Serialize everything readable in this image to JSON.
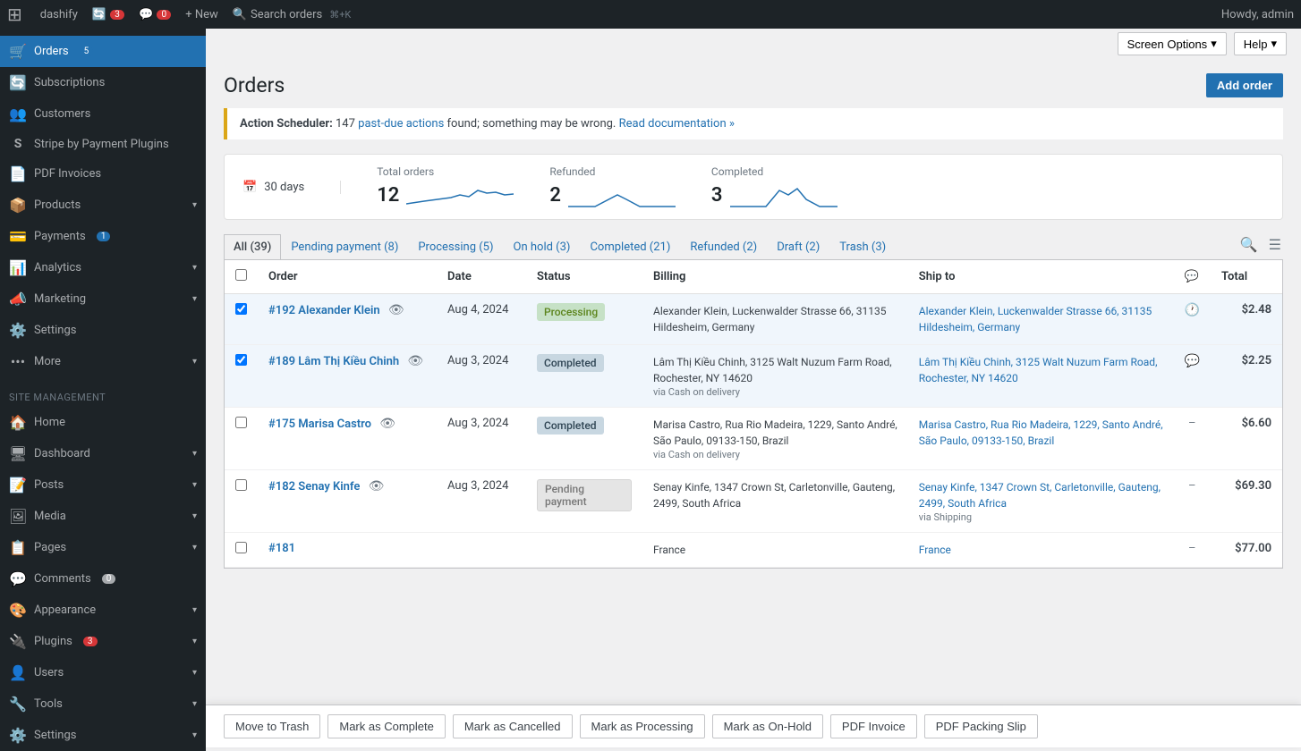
{
  "adminbar": {
    "logo": "W",
    "site_name": "dashify",
    "updates_count": "3",
    "comments_count": "0",
    "new_label": "+ New",
    "search_label": "Search orders",
    "search_shortcut": "⌘+K",
    "howdy": "Howdy, admin"
  },
  "top_bar": {
    "screen_options": "Screen Options",
    "help": "Help"
  },
  "page": {
    "title": "Orders",
    "add_order_label": "Add order"
  },
  "notice": {
    "prefix": "Action Scheduler:",
    "count": "147",
    "link1_text": "past-due actions",
    "middle": "found; something may be wrong.",
    "link2_text": "Read documentation »"
  },
  "stats": {
    "period_icon": "📅",
    "period_label": "30 days",
    "total_orders_label": "Total orders",
    "total_orders_value": "12",
    "refunded_label": "Refunded",
    "refunded_value": "2",
    "completed_label": "Completed",
    "completed_value": "3"
  },
  "tabs": [
    {
      "label": "All (39)",
      "key": "all",
      "active": true
    },
    {
      "label": "Pending payment (8)",
      "key": "pending",
      "active": false
    },
    {
      "label": "Processing (5)",
      "key": "processing",
      "active": false
    },
    {
      "label": "On hold (3)",
      "key": "on-hold",
      "active": false
    },
    {
      "label": "Completed (21)",
      "key": "completed",
      "active": false
    },
    {
      "label": "Refunded (2)",
      "key": "refunded",
      "active": false
    },
    {
      "label": "Draft (2)",
      "key": "draft",
      "active": false
    },
    {
      "label": "Trash (3)",
      "key": "trash",
      "active": false
    }
  ],
  "table": {
    "headers": [
      "",
      "Order",
      "Date",
      "Status",
      "Billing",
      "Ship to",
      "",
      "Total"
    ],
    "rows": [
      {
        "selected": true,
        "order_num": "#192 Alexander Klein",
        "date": "Aug 4, 2024",
        "status": "Processing",
        "status_key": "processing",
        "billing_name": "Alexander Klein, Luckenwalder Strasse 66, 31135 Hildesheim, Germany",
        "billing_method": "",
        "ship_name": "Alexander Klein, Luckenwalder Strasse 66, 31135 Hildesheim, Germany",
        "ship_method": "",
        "icon_type": "clock",
        "total": "$2.48"
      },
      {
        "selected": true,
        "order_num": "#189 Lâm Thị Kiều Chinh",
        "date": "Aug 3, 2024",
        "status": "Completed",
        "status_key": "completed",
        "billing_name": "Lâm Thị Kiều Chinh, 3125 Walt Nuzum Farm Road, Rochester, NY 14620",
        "billing_method": "via Cash on delivery",
        "ship_name": "Lâm Thị Kiều Chinh, 3125 Walt Nuzum Farm Road, Rochester, NY 14620",
        "ship_method": "",
        "icon_type": "message",
        "total": "$2.25"
      },
      {
        "selected": false,
        "order_num": "#175 Marisa Castro",
        "date": "Aug 3, 2024",
        "status": "Completed",
        "status_key": "completed",
        "billing_name": "Marisa Castro, Rua Rio Madeira, 1229, Santo André, São Paulo, 09133-150, Brazil",
        "billing_method": "via Cash on delivery",
        "ship_name": "Marisa Castro, Rua Rio Madeira, 1229, Santo André, São Paulo, 09133-150, Brazil",
        "ship_method": "",
        "icon_type": "dash",
        "total": "$6.60"
      },
      {
        "selected": false,
        "order_num": "#182 Senay Kinfe",
        "date": "Aug 3, 2024",
        "status": "Pending payment",
        "status_key": "pending",
        "billing_name": "Senay Kinfe, 1347 Crown St, Carletonville, Gauteng, 2499, South Africa",
        "billing_method": "",
        "ship_name": "Senay Kinfe, 1347 Crown St, Carletonville, Gauteng, 2499, South Africa",
        "ship_method": "via Shipping",
        "icon_type": "dash",
        "total": "$69.30"
      },
      {
        "selected": false,
        "order_num": "#181",
        "date": "",
        "status": "",
        "status_key": "",
        "billing_name": "France",
        "billing_method": "",
        "ship_name": "France",
        "ship_method": "",
        "icon_type": "dash",
        "total": "$77.00"
      }
    ]
  },
  "bulk_actions": [
    {
      "key": "move-to-trash",
      "label": "Move to Trash"
    },
    {
      "key": "mark-complete",
      "label": "Mark as Complete"
    },
    {
      "key": "mark-cancelled",
      "label": "Mark as Cancelled"
    },
    {
      "key": "mark-processing",
      "label": "Mark as Processing"
    },
    {
      "key": "mark-on-hold",
      "label": "Mark as On-Hold"
    },
    {
      "key": "pdf-invoice",
      "label": "PDF Invoice"
    },
    {
      "key": "pdf-packing-slip",
      "label": "PDF Packing Slip"
    }
  ],
  "sidebar": {
    "woocommerce_items": [
      {
        "key": "orders",
        "icon": "🛒",
        "label": "Orders",
        "badge": "5",
        "active": true
      },
      {
        "key": "subscriptions",
        "icon": "🔄",
        "label": "Subscriptions",
        "badge": ""
      },
      {
        "key": "customers",
        "icon": "👥",
        "label": "Customers",
        "badge": ""
      },
      {
        "key": "stripe",
        "icon": "S",
        "label": "Stripe by Payment Plugins",
        "badge": ""
      },
      {
        "key": "pdf-invoices",
        "icon": "📄",
        "label": "PDF Invoices",
        "badge": ""
      },
      {
        "key": "products",
        "icon": "📦",
        "label": "Products",
        "badge": "",
        "arrow": true
      },
      {
        "key": "payments",
        "icon": "💳",
        "label": "Payments",
        "badge": "1"
      },
      {
        "key": "analytics",
        "icon": "📊",
        "label": "Analytics",
        "badge": "",
        "arrow": true
      },
      {
        "key": "marketing",
        "icon": "📣",
        "label": "Marketing",
        "badge": "",
        "arrow": true
      },
      {
        "key": "settings",
        "icon": "⚙️",
        "label": "Settings",
        "badge": ""
      },
      {
        "key": "more",
        "icon": "···",
        "label": "More",
        "badge": "",
        "arrow": true
      }
    ],
    "site_label": "Site management",
    "site_items": [
      {
        "key": "home",
        "icon": "🏠",
        "label": "Home",
        "badge": ""
      },
      {
        "key": "dashboard",
        "icon": "🖥",
        "label": "Dashboard",
        "badge": "",
        "arrow": true
      },
      {
        "key": "posts",
        "icon": "📝",
        "label": "Posts",
        "badge": "",
        "arrow": true
      },
      {
        "key": "media",
        "icon": "🖼",
        "label": "Media",
        "badge": "",
        "arrow": true
      },
      {
        "key": "pages",
        "icon": "📋",
        "label": "Pages",
        "badge": "",
        "arrow": true
      },
      {
        "key": "comments",
        "icon": "💬",
        "label": "Comments",
        "badge": "0"
      },
      {
        "key": "appearance",
        "icon": "🎨",
        "label": "Appearance",
        "badge": "",
        "arrow": true
      },
      {
        "key": "plugins",
        "icon": "🔌",
        "label": "Plugins",
        "badge": "3",
        "arrow": true
      },
      {
        "key": "users",
        "icon": "👤",
        "label": "Users",
        "badge": "",
        "arrow": true
      },
      {
        "key": "tools",
        "icon": "🔧",
        "label": "Tools",
        "badge": "",
        "arrow": true
      },
      {
        "key": "site-settings",
        "icon": "⚙️",
        "label": "Settings",
        "badge": "",
        "arrow": true
      }
    ]
  }
}
